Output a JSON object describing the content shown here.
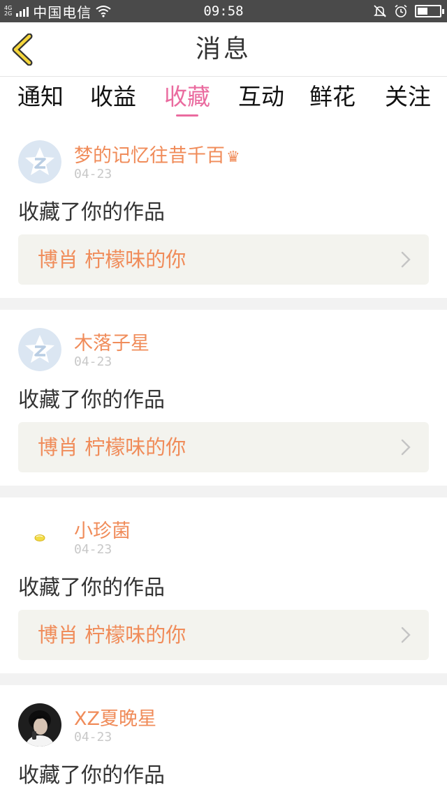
{
  "status_bar": {
    "network_top": "4G",
    "network_bottom": "2G",
    "carrier": "中国电信",
    "time": "09:58",
    "battery_level": 0.45
  },
  "header": {
    "title": "消息"
  },
  "tabs": [
    {
      "label": "通知",
      "active": false
    },
    {
      "label": "收益",
      "active": false
    },
    {
      "label": "收藏",
      "active": true
    },
    {
      "label": "互动",
      "active": false
    },
    {
      "label": "鲜花",
      "active": false
    },
    {
      "label": "关注",
      "active": false
    }
  ],
  "colors": {
    "accent_tab": "#ea6b9f",
    "name_color": "#f08c5a",
    "card_link_bg": "#f3f3ee"
  },
  "messages": [
    {
      "user": "梦的记忆往昔千百",
      "crown": "♛",
      "date": "04-23",
      "action": "收藏了你的作品",
      "work_title": "博肖 柠檬味的你",
      "avatar": "qzone-default-icon"
    },
    {
      "user": "木落子星",
      "date": "04-23",
      "action": "收藏了你的作品",
      "work_title": "博肖 柠檬味的你",
      "avatar": "qzone-default-icon"
    },
    {
      "user": "小珍菌",
      "date": "04-23",
      "action": "收藏了你的作品",
      "work_title": "博肖 柠檬味的你",
      "avatar": "lemon-icon"
    },
    {
      "user": "XZ夏晚星",
      "date": "04-23",
      "action": "收藏了你的作品",
      "avatar": "photo-avatar"
    }
  ]
}
